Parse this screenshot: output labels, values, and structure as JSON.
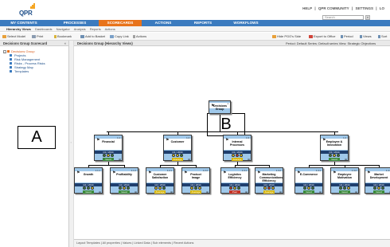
{
  "app": {
    "logo": "QPR",
    "logo_bar_color": "#f5a623"
  },
  "top_links": [
    "HELP",
    "|",
    "QPR COMMUNITY",
    "|",
    "SETTINGS",
    "|",
    "LO"
  ],
  "search": {
    "placeholder": "Search",
    "button_icon": "search-icon"
  },
  "main_nav": {
    "items": [
      "MY CONTENTS",
      "PROCESSES",
      "SCORECARDS",
      "ACTIONS",
      "REPORTS",
      "WORKFLOWS"
    ],
    "active": "SCORECARDS",
    "active_color": "#e8731b",
    "bar_color": "#3b7bbf"
  },
  "sub_nav": {
    "items": [
      "Hierarchy Views",
      "Dashboards",
      "Navigator",
      "Analysis",
      "Reports",
      "Actions"
    ]
  },
  "toolbar": {
    "items": [
      "Select Model",
      "Print",
      "Bookmark",
      "Add to Basket",
      "Copy Link",
      "Actions"
    ],
    "right_items": [
      "Hide PGO's Side",
      "Export to Office",
      "Period",
      "Views",
      "Sort"
    ]
  },
  "left_panel": {
    "title": "Decisions Group Scorecard",
    "close": "«",
    "tree": {
      "root": "Decisions Group",
      "children": [
        "Projects",
        "Risk Management",
        "Risks - Process Risks",
        "Strategy Map",
        "Templates"
      ]
    }
  },
  "main_panel": {
    "title": "Decisions Group (Hierarchy Views)",
    "meta": "Period: Default  Series: Default series  View: Strategic Objectives"
  },
  "annotations": {
    "a": "A",
    "b": "B"
  },
  "org_chart": {
    "root": {
      "name": "Decisions Group",
      "ref": "1"
    },
    "level1": [
      {
        "name": "Financial",
        "ref": "1.1",
        "period": "Q1 / 2014",
        "status": "Good",
        "status_color": "#3c8a3c",
        "dots": [
          "#3c8a3c",
          "#f0d020",
          "#3c8a3c"
        ]
      },
      {
        "name": "Customer",
        "ref": "1.2",
        "period": "Q1 / 2014",
        "status": "Average",
        "status_color": "#d7b400",
        "dots": [
          "#f0d020",
          "#f0d020",
          "#3c8a3c"
        ]
      },
      {
        "name": "Internal Processes",
        "ref": "1.3",
        "period": "Q1 / 2014",
        "status": "Average",
        "status_color": "#d7b400",
        "dots": [
          "#f0d020",
          "#d83a2a",
          "#f0d020"
        ]
      },
      {
        "name": "Employee & Innovation",
        "ref": "1.4",
        "period": "Q1 / 2014",
        "status": "Good",
        "status_color": "#3c8a3c",
        "dots": [
          "#3c8a3c",
          "#f0d020",
          "#3c8a3c"
        ]
      }
    ],
    "level2": [
      {
        "name": "Growth",
        "ref": "1.1.1",
        "period": "Q1 / 2014",
        "status": "Good",
        "status_color": "#3c8a3c",
        "dots": [
          "#3c8a3c",
          "#3c8a3c",
          "#f0d020"
        ]
      },
      {
        "name": "Profitability",
        "ref": "1.1.2",
        "period": "Q1 / 2014",
        "status": "Good",
        "status_color": "#3c8a3c",
        "dots": [
          "#3c8a3c",
          "#f0d020",
          "#3c8a3c"
        ]
      },
      {
        "name": "Customer Satisfaction",
        "ref": "1.2.1",
        "period": "Q1 / 2014",
        "status": "Average",
        "status_color": "#d7b400",
        "dots": [
          "#f0d020",
          "#f0d020",
          "#3c8a3c"
        ]
      },
      {
        "name": "Product Image",
        "ref": "1.2.2",
        "period": "Q1 / 2014",
        "status": "Average",
        "status_color": "#d7b400",
        "dots": [
          "#f0d020",
          "#3c8a3c",
          "#f0d020"
        ]
      },
      {
        "name": "Logistics Efficiency",
        "ref": "1.3.1",
        "period": "Q1 / 2014",
        "status": "Poor",
        "status_color": "#c43224",
        "dots": [
          "#d83a2a",
          "#f0d020",
          "#3c8a3c"
        ]
      },
      {
        "name": "Marketing Communications Efficiency",
        "ref": "1.3.2",
        "period": "Q1 / 2014",
        "status": "Average",
        "status_color": "#d7b400",
        "dots": [
          "#f0d020",
          "#d83a2a",
          "#f0d020"
        ]
      },
      {
        "name": "E-Commerce",
        "ref": "1.4.1",
        "period": "Q1 / 2014",
        "status": "Good",
        "status_color": "#3c8a3c",
        "dots": [
          "#3c8a3c",
          "#f0d020",
          "#3c8a3c"
        ]
      },
      {
        "name": "Employee Motivation",
        "ref": "1.4.2",
        "period": "Q1 / 2014",
        "status": "Good",
        "status_color": "#3c8a3c",
        "dots": [
          "#3c8a3c",
          "#3c8a3c",
          "#f0d020"
        ]
      },
      {
        "name": "Market Development",
        "ref": "1.4.3",
        "period": "Q1 / 2014",
        "status": "Good",
        "status_color": "#3c8a3c",
        "dots": [
          "#3c8a3c",
          "#f0d020",
          "#3c8a3c"
        ]
      }
    ]
  },
  "bottom_tabs": [
    "Layout Templates",
    "|",
    "All properties",
    "|",
    "Values",
    "|",
    "Linked Data",
    "|",
    "Sub elements",
    "|",
    "Recent Actions"
  ]
}
